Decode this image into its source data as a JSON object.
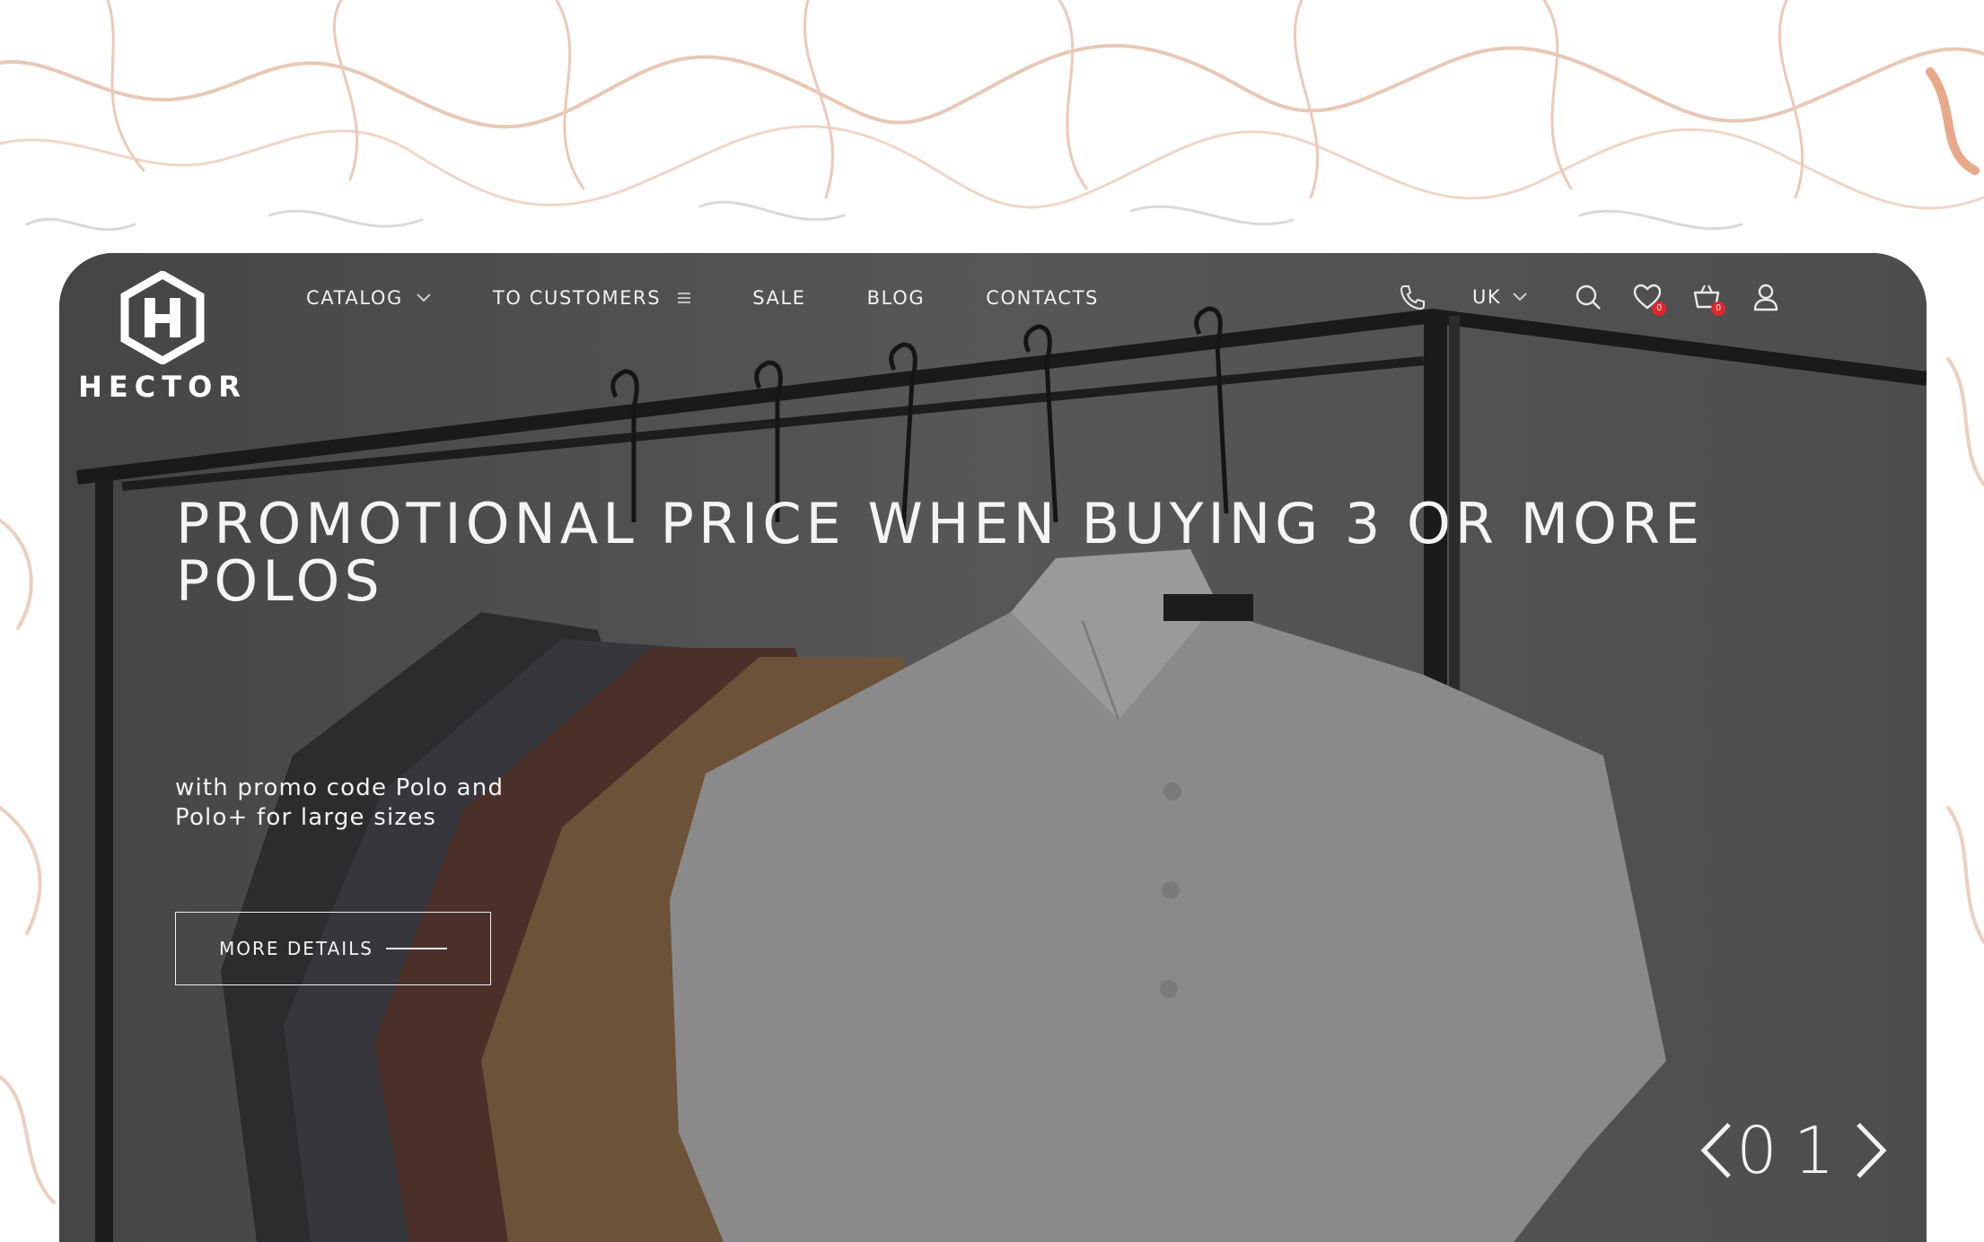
{
  "brand": {
    "name": "HECTOR"
  },
  "nav": [
    {
      "label": "CATALOG",
      "icon": "chevron-down-icon"
    },
    {
      "label": "TO CUSTOMERS",
      "icon": "menu-icon"
    },
    {
      "label": "SALE"
    },
    {
      "label": "BLOG"
    },
    {
      "label": "CONTACTS"
    }
  ],
  "tools": {
    "phone_icon": "phone-icon",
    "language": "UK",
    "search_icon": "search-icon",
    "wishlist_icon": "heart-icon",
    "wishlist_count": "0",
    "cart_icon": "basket-icon",
    "cart_count": "0",
    "account_icon": "user-icon"
  },
  "hero": {
    "headline": "PROMOTIONAL PRICE WHEN BUYING 3 OR MORE POLOS",
    "subline": "with promo code Polo and Polo+ for large sizes",
    "cta_label": "MORE DETAILS",
    "slide_counter": "01"
  },
  "colors": {
    "badge": "#e3262b",
    "text": "#f4f4f4",
    "overlay": "#4a4a4a"
  }
}
